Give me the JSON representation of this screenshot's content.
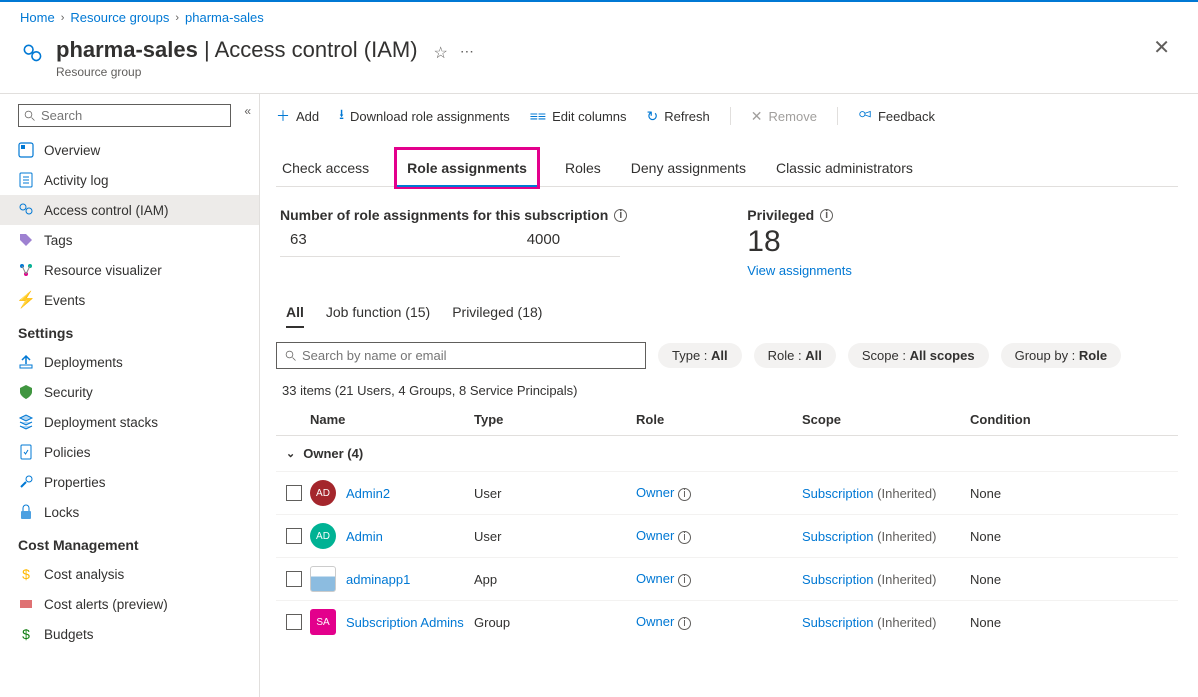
{
  "breadcrumb": {
    "home": "Home",
    "rg": "Resource groups",
    "name": "pharma-sales"
  },
  "header": {
    "title": "pharma-sales",
    "section": "Access control (IAM)",
    "subtitle": "Resource group"
  },
  "sidebar": {
    "search_placeholder": "Search",
    "items_top": [
      {
        "icon": "overview",
        "label": "Overview"
      },
      {
        "icon": "activity",
        "label": "Activity log"
      },
      {
        "icon": "iam",
        "label": "Access control (IAM)",
        "active": true
      },
      {
        "icon": "tags",
        "label": "Tags"
      },
      {
        "icon": "visualizer",
        "label": "Resource visualizer"
      },
      {
        "icon": "events",
        "label": "Events"
      }
    ],
    "heading_settings": "Settings",
    "items_settings": [
      {
        "icon": "deploy",
        "label": "Deployments"
      },
      {
        "icon": "security",
        "label": "Security"
      },
      {
        "icon": "stacks",
        "label": "Deployment stacks"
      },
      {
        "icon": "policies",
        "label": "Policies"
      },
      {
        "icon": "properties",
        "label": "Properties"
      },
      {
        "icon": "locks",
        "label": "Locks"
      }
    ],
    "heading_cost": "Cost Management",
    "items_cost": [
      {
        "icon": "cost",
        "label": "Cost analysis"
      },
      {
        "icon": "alerts",
        "label": "Cost alerts (preview)"
      },
      {
        "icon": "budgets",
        "label": "Budgets"
      }
    ]
  },
  "toolbar": {
    "add": "Add",
    "download": "Download role assignments",
    "edit": "Edit columns",
    "refresh": "Refresh",
    "remove": "Remove",
    "feedback": "Feedback"
  },
  "subtabs": {
    "check": "Check access",
    "roleassign": "Role assignments",
    "roles": "Roles",
    "deny": "Deny assignments",
    "classic": "Classic administrators"
  },
  "stats": {
    "count_label": "Number of role assignments for this subscription",
    "count_current": "63",
    "count_max": "4000",
    "priv_label": "Privileged",
    "priv_count": "18",
    "priv_link": "View assignments"
  },
  "filter_tabs": {
    "all": "All",
    "job": "Job function (15)",
    "priv": "Privileged (18)"
  },
  "filter": {
    "search_placeholder": "Search by name or email",
    "type": "All",
    "role": "All",
    "scope": "All scopes",
    "group": "Role",
    "type_lbl": "Type : ",
    "role_lbl": "Role : ",
    "scope_lbl": "Scope : ",
    "group_lbl": "Group by : "
  },
  "results": "33 items (21 Users, 4 Groups, 8 Service Principals)",
  "columns": {
    "name": "Name",
    "type": "Type",
    "role": "Role",
    "scope": "Scope",
    "cond": "Condition"
  },
  "group_header": "Owner (4)",
  "rows": [
    {
      "avatar": "AD",
      "av_cls": "av-red",
      "name": "Admin2",
      "type": "User",
      "role": "Owner",
      "scope": "Subscription",
      "scope_extra": "(Inherited)",
      "cond": "None"
    },
    {
      "avatar": "AD",
      "av_cls": "av-teal",
      "name": "Admin",
      "type": "User",
      "role": "Owner",
      "scope": "Subscription",
      "scope_extra": "(Inherited)",
      "cond": "None"
    },
    {
      "avatar": "",
      "av_cls": "av-blue sq",
      "name": "adminapp1",
      "type": "App",
      "role": "Owner",
      "scope": "Subscription",
      "scope_extra": "(Inherited)",
      "cond": "None"
    },
    {
      "avatar": "SA",
      "av_cls": "av-pink sq",
      "name": "Subscription Admins",
      "type": "Group",
      "role": "Owner",
      "scope": "Subscription",
      "scope_extra": "(Inherited)",
      "cond": "None"
    }
  ]
}
